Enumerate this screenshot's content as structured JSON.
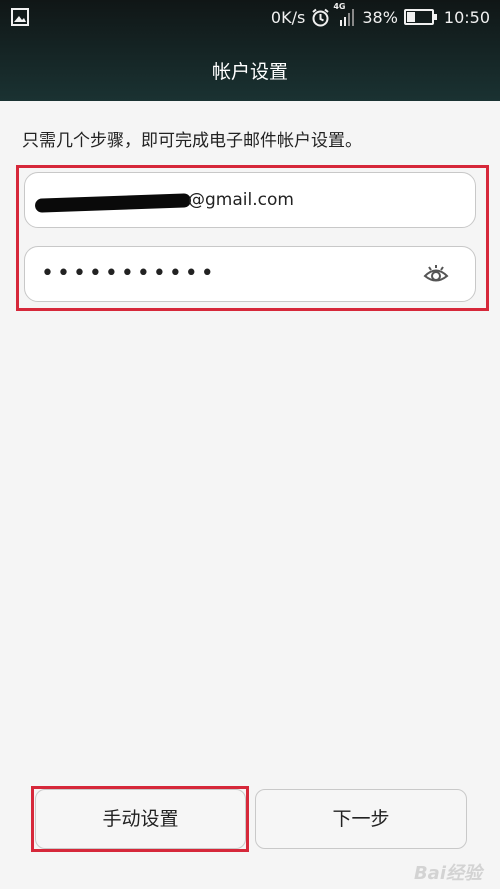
{
  "status_bar": {
    "net_speed": "0K/s",
    "network_type": "4G",
    "battery_percent": "38%",
    "battery_level": 0.38,
    "time": "10:50",
    "icons": [
      "photo-icon",
      "alarm-icon",
      "signal-icon",
      "battery-icon"
    ]
  },
  "header": {
    "title": "帐户设置"
  },
  "intro": {
    "text": "只需几个步骤，即可完成电子邮件帐户设置。"
  },
  "form": {
    "email_visible_part": "@gmail.com",
    "password_mask": "•••••••••••",
    "show_password_icon": "eye-icon"
  },
  "buttons": {
    "manual_setup": "手动设置",
    "next": "下一步"
  },
  "watermark": "Bai经验",
  "colors": {
    "highlight": "#d6283a",
    "header": "#132525"
  }
}
